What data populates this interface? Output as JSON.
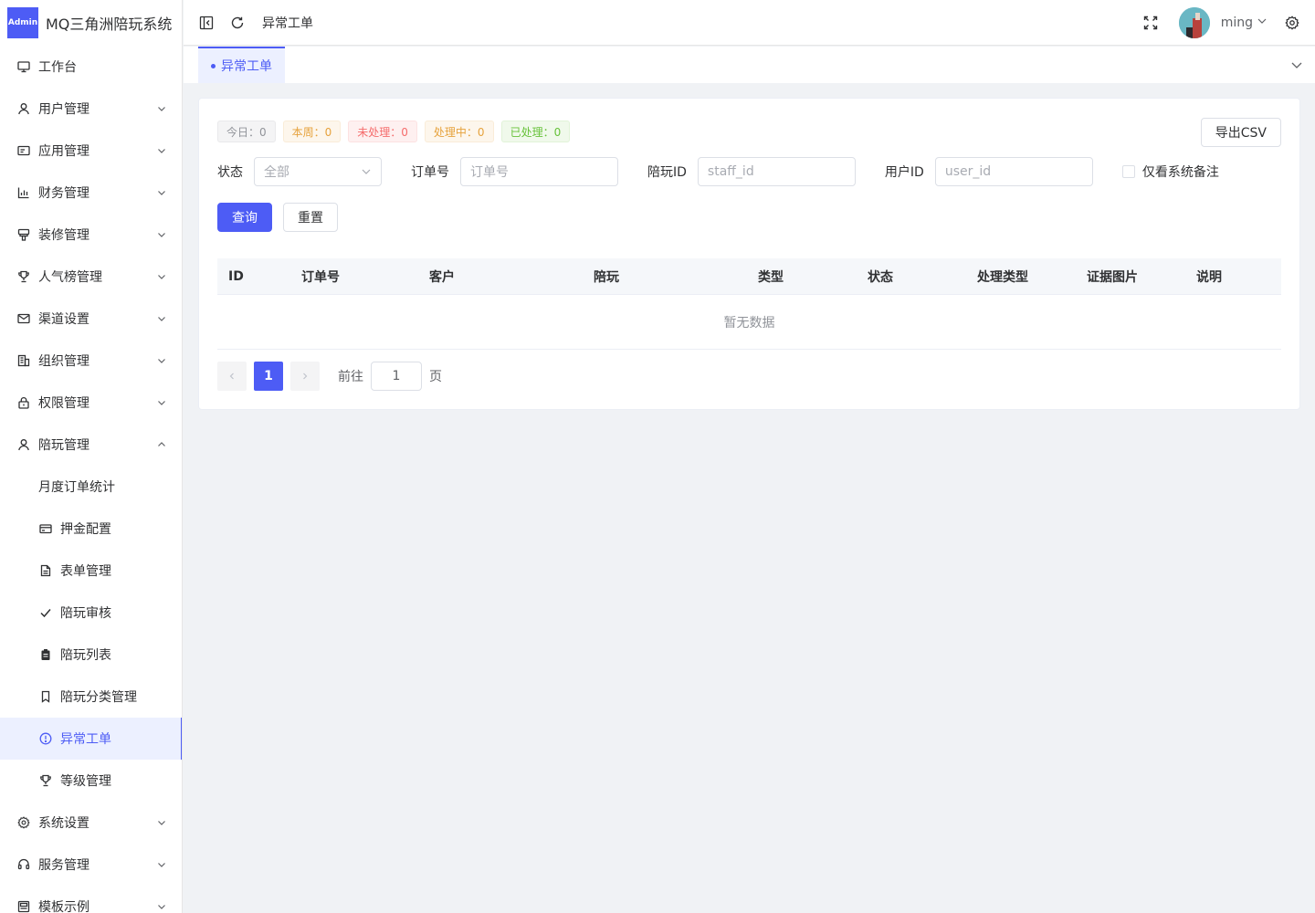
{
  "app": {
    "logo_badge": "Admin",
    "title": "MQ三角洲陪玩系统"
  },
  "sidebar": {
    "items": [
      {
        "label": "工作台",
        "icon": "monitor-icon",
        "expandable": false
      },
      {
        "label": "用户管理",
        "icon": "user-icon",
        "expandable": true
      },
      {
        "label": "应用管理",
        "icon": "app-card-icon",
        "expandable": true
      },
      {
        "label": "财务管理",
        "icon": "chart-icon",
        "expandable": true
      },
      {
        "label": "装修管理",
        "icon": "brush-icon",
        "expandable": true
      },
      {
        "label": "人气榜管理",
        "icon": "trophy-icon",
        "expandable": true
      },
      {
        "label": "渠道设置",
        "icon": "mail-icon",
        "expandable": true
      },
      {
        "label": "组织管理",
        "icon": "building-icon",
        "expandable": true
      },
      {
        "label": "权限管理",
        "icon": "lock-icon",
        "expandable": true
      },
      {
        "label": "陪玩管理",
        "icon": "user-icon",
        "expandable": true,
        "expanded": true
      }
    ],
    "sub_items": [
      {
        "label": "月度订单统计",
        "icon": ""
      },
      {
        "label": "押金配置",
        "icon": "credit-card-icon"
      },
      {
        "label": "表单管理",
        "icon": "document-icon"
      },
      {
        "label": "陪玩审核",
        "icon": "check-icon"
      },
      {
        "label": "陪玩列表",
        "icon": "clipboard-icon"
      },
      {
        "label": "陪玩分类管理",
        "icon": "bookmark-icon"
      },
      {
        "label": "异常工单",
        "icon": "info-circle-icon",
        "active": true
      },
      {
        "label": "等级管理",
        "icon": "trophy-icon"
      }
    ],
    "bottom_items": [
      {
        "label": "系统设置",
        "icon": "gear-icon",
        "expandable": true
      },
      {
        "label": "服务管理",
        "icon": "headset-icon",
        "expandable": true
      },
      {
        "label": "模板示例",
        "icon": "template-icon",
        "expandable": true
      }
    ]
  },
  "header": {
    "breadcrumb": "异常工单",
    "username": "ming"
  },
  "tabs": [
    {
      "label": "异常工单",
      "active": true
    }
  ],
  "stats": [
    {
      "label": "今日：0",
      "color": "#909399",
      "bg": "#f4f4f5",
      "border": "#e9e9eb"
    },
    {
      "label": "本周：0",
      "color": "#e6a23c",
      "bg": "#fdf6ec",
      "border": "#faecd8"
    },
    {
      "label": "未处理：0",
      "color": "#f56c6c",
      "bg": "#fef0f0",
      "border": "#fde2e2"
    },
    {
      "label": "处理中：0",
      "color": "#e6a23c",
      "bg": "#fdf6ec",
      "border": "#faecd8"
    },
    {
      "label": "已处理：0",
      "color": "#67c23a",
      "bg": "#f0f9eb",
      "border": "#e1f3d8"
    }
  ],
  "export_label": "导出CSV",
  "filters": {
    "status_label": "状态",
    "status_value": "全部",
    "order_label": "订单号",
    "order_placeholder": "订单号",
    "staff_label": "陪玩ID",
    "staff_placeholder": "staff_id",
    "user_label": "用户ID",
    "user_placeholder": "user_id",
    "only_system_note": "仅看系统备注",
    "only_system_note_checked": false
  },
  "buttons": {
    "query": "查询",
    "reset": "重置"
  },
  "table": {
    "columns": [
      "ID",
      "订单号",
      "客户",
      "陪玩",
      "类型",
      "状态",
      "处理类型",
      "证据图片",
      "说明"
    ],
    "rows": [],
    "empty_text": "暂无数据"
  },
  "pagination": {
    "current_page": "1",
    "goto_label": "前往",
    "goto_value": "1",
    "page_suffix": "页"
  },
  "colors": {
    "accent": "#4d5cf5"
  }
}
